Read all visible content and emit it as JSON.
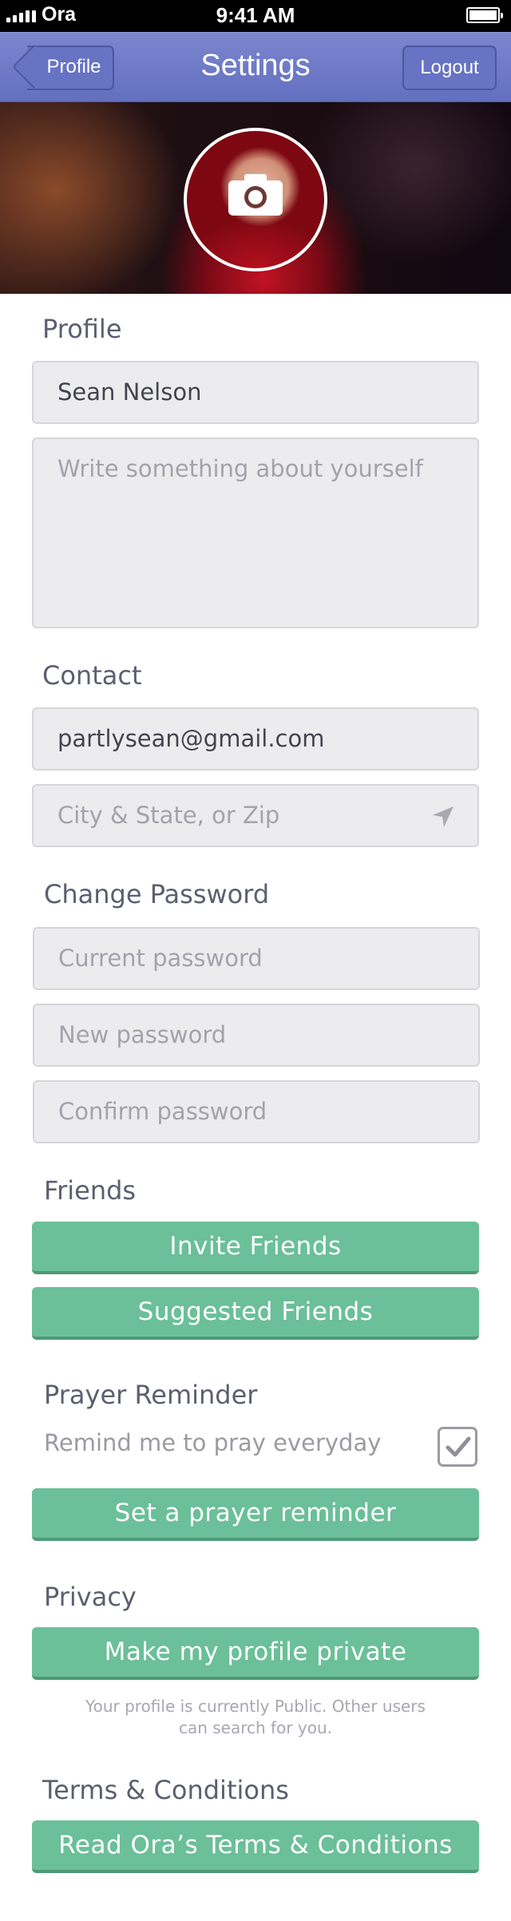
{
  "status_bar": {
    "carrier": "Ora",
    "time": "9:41 AM"
  },
  "nav": {
    "title": "Settings",
    "back_label": "Profile",
    "logout_label": "Logout"
  },
  "profile": {
    "section_title": "Profile",
    "name_value": "Sean Nelson",
    "about_placeholder": "Write something about yourself"
  },
  "contact": {
    "section_title": "Contact",
    "email_value": "partlysean@gmail.com",
    "location_placeholder": "City & State, or Zip"
  },
  "password": {
    "section_title": "Change Password",
    "current_placeholder": "Current password",
    "new_placeholder": "New password",
    "confirm_placeholder": "Confirm password"
  },
  "friends": {
    "section_title": "Friends",
    "invite_label": "Invite Friends",
    "suggested_label": "Suggested Friends"
  },
  "prayer": {
    "section_title": "Prayer Reminder",
    "remind_text": "Remind me to pray everyday",
    "remind_checked": true,
    "set_reminder_label": "Set a prayer reminder"
  },
  "privacy": {
    "section_title": "Privacy",
    "private_label": "Make my profile private",
    "note_line1": "Your profile is currently Public. Other users",
    "note_line2": "can search for you."
  },
  "terms": {
    "section_title": "Terms & Conditions",
    "read_label": "Read Ora’s Terms & Conditions"
  },
  "icons": {
    "camera": "camera-icon",
    "location": "location-arrow-icon",
    "check": "checkmark-icon",
    "back": "chevron-left-icon"
  },
  "colors": {
    "nav_bar": "#6d79c7",
    "button_green": "#6bbf99",
    "field_bg": "#ececee",
    "section_title": "#5b5f6f"
  }
}
